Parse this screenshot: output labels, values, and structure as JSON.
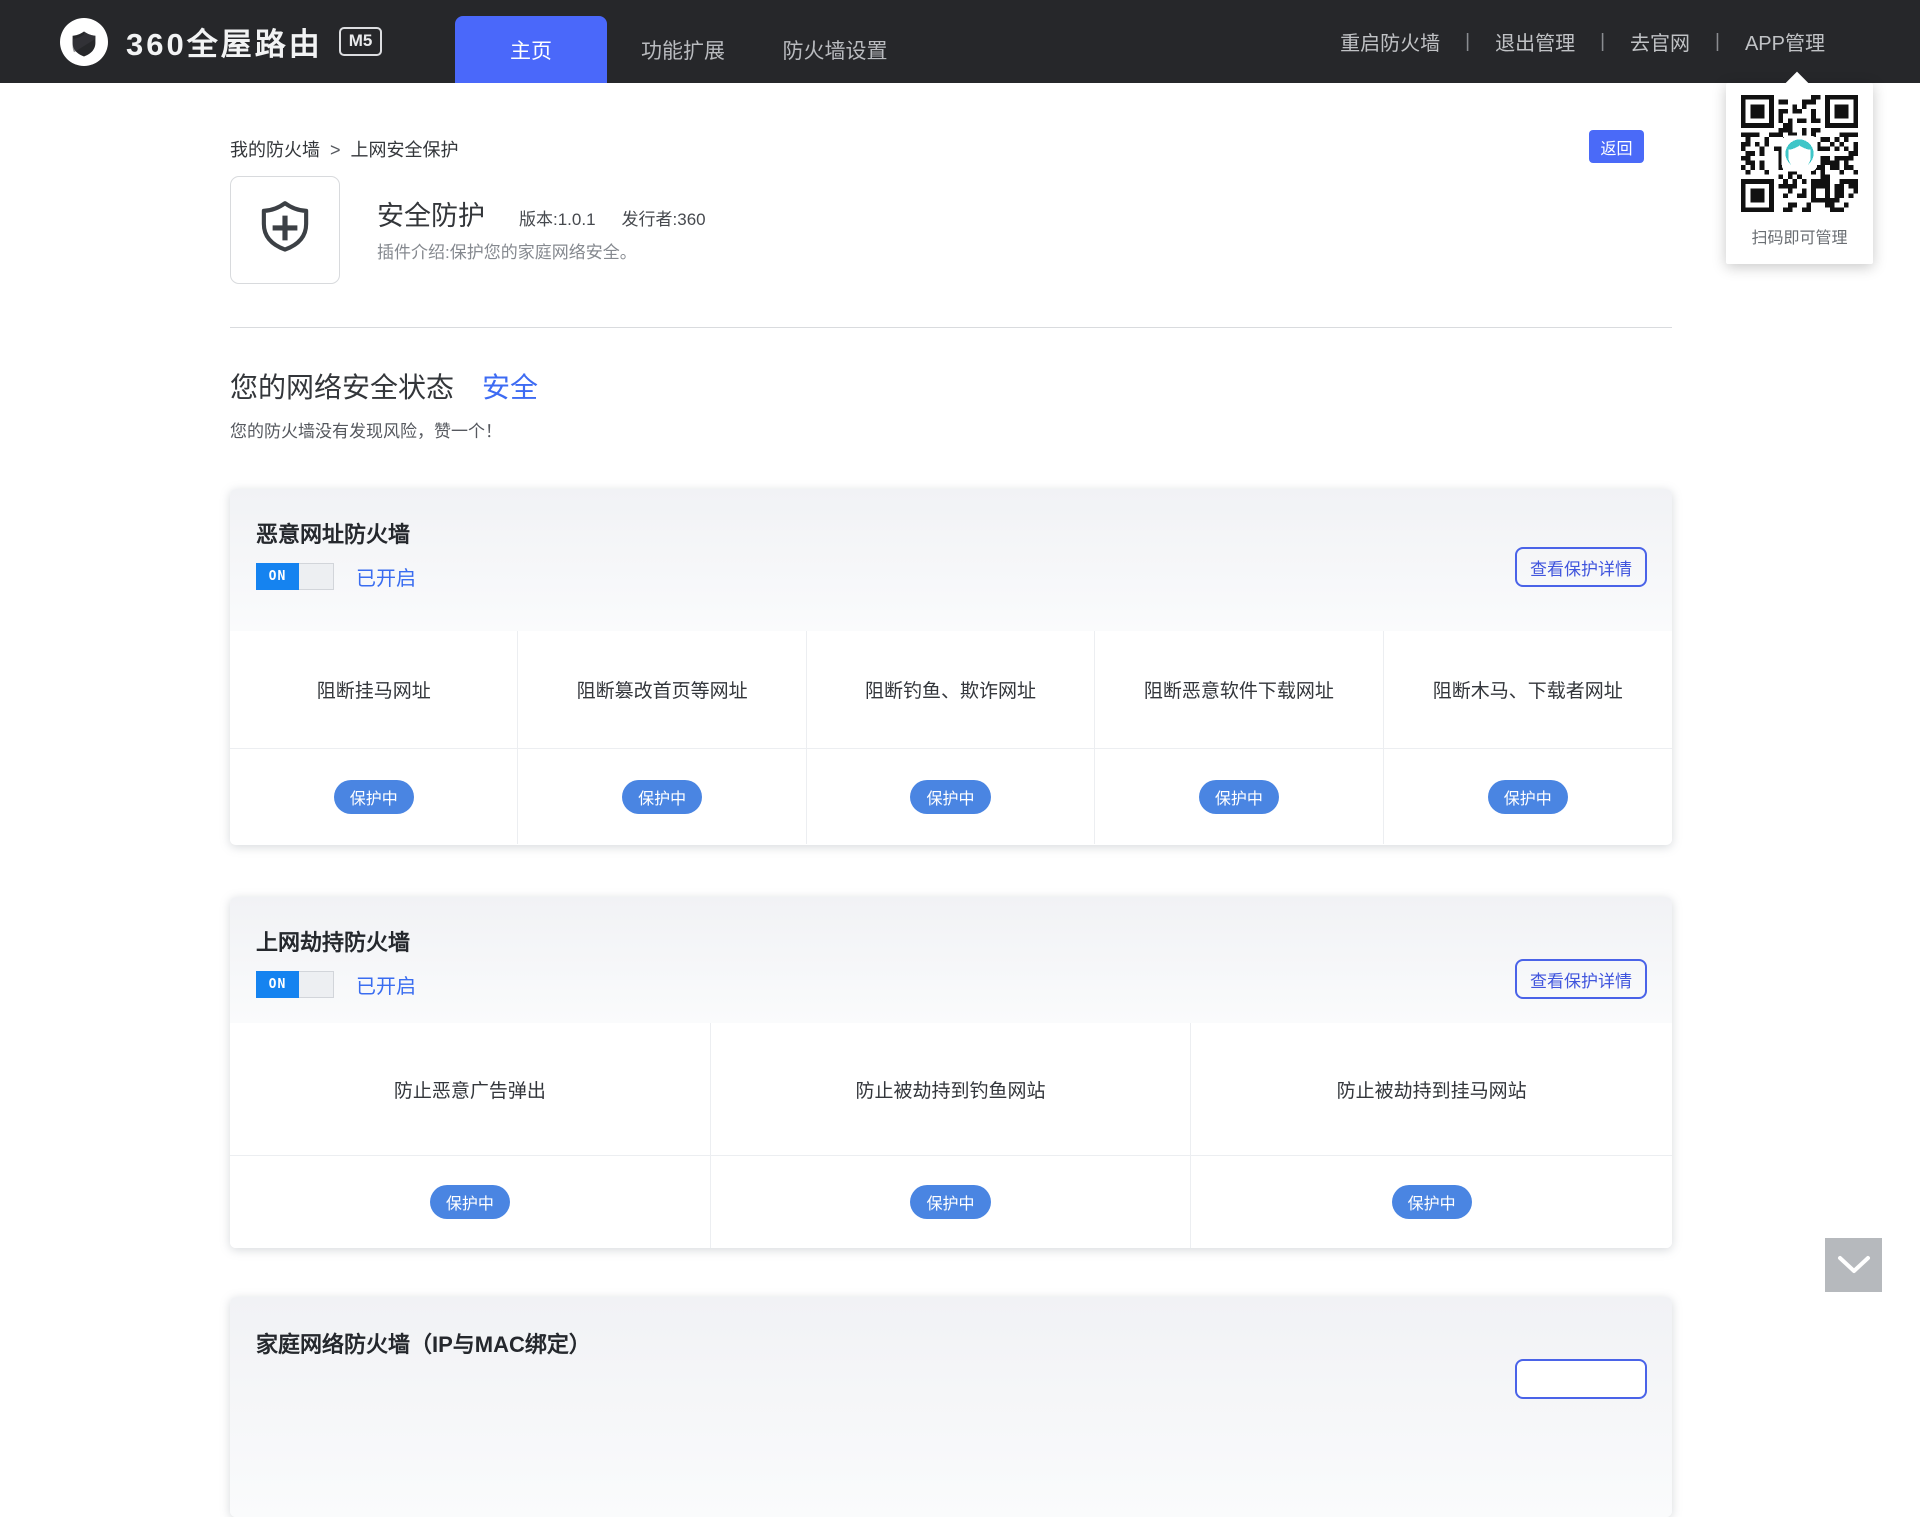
{
  "navbar": {
    "brand": {
      "name": "360全屋路由",
      "model": "M5"
    },
    "tabs": [
      {
        "label": "主页",
        "active": true
      },
      {
        "label": "功能扩展",
        "active": false
      },
      {
        "label": "防火墙设置",
        "active": false
      }
    ],
    "separator": "|",
    "links": {
      "restart": "重启防火墙",
      "logout": "退出管理",
      "official_site": "去官网",
      "app_manage": "APP管理"
    }
  },
  "qr_popover": {
    "caption": "扫码即可管理"
  },
  "page": {
    "breadcrumb": {
      "root": "我的防火墙",
      "separator": ">",
      "current": "上网安全保护"
    },
    "back_label": "返回",
    "plugin": {
      "title": "安全防护",
      "version": "版本:1.0.1",
      "publisher": "发行者:360",
      "description": "插件介绍:保护您的家庭网络安全。"
    },
    "status": {
      "title": "您的网络安全状态",
      "value": "安全",
      "subtitle": "您的防火墙没有发现风险，赞一个！"
    }
  },
  "cards": [
    {
      "title": "恶意网址防火墙",
      "toggle": {
        "label": "ON",
        "on": true
      },
      "state": "已开启",
      "detail_button": "查看保护详情",
      "items": [
        {
          "label": "阻断挂马网址",
          "status": "保护中"
        },
        {
          "label": "阻断篡改首页等网址",
          "status": "保护中"
        },
        {
          "label": "阻断钓鱼、欺诈网址",
          "status": "保护中"
        },
        {
          "label": "阻断恶意软件下载网址",
          "status": "保护中"
        },
        {
          "label": "阻断木马、下载者网址",
          "status": "保护中"
        }
      ]
    },
    {
      "title": "上网劫持防火墙",
      "toggle": {
        "label": "ON",
        "on": true
      },
      "state": "已开启",
      "detail_button": "查看保护详情",
      "items": [
        {
          "label": "防止恶意广告弹出",
          "status": "保护中"
        },
        {
          "label": "防止被劫持到钓鱼网站",
          "status": "保护中"
        },
        {
          "label": "防止被劫持到挂马网站",
          "status": "保护中"
        }
      ]
    },
    {
      "title": "家庭网络防火墙（IP与MAC绑定）"
    }
  ],
  "colors": {
    "navbar_bg": "#26272a",
    "accent_blue": "#4a68fa",
    "toggle_on_blue": "#1583f0",
    "status_pill_blue": "#4a85e2",
    "link_blue": "#3a6df0",
    "outline_button_blue": "#4a63e8"
  }
}
